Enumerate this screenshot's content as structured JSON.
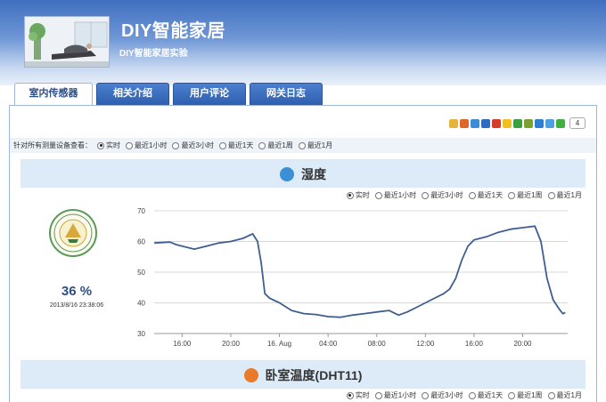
{
  "header": {
    "title": "DIY智能家居",
    "subtitle": "DIY智能家居实验"
  },
  "tabs": [
    {
      "label": "室内传感器",
      "active": true
    },
    {
      "label": "相关介绍",
      "active": false
    },
    {
      "label": "用户评论",
      "active": false
    },
    {
      "label": "网关日志",
      "active": false
    }
  ],
  "share": {
    "icons": [
      "qzone-icon",
      "rss-icon",
      "email-icon",
      "renren-icon",
      "weibo-icon",
      "star-icon",
      "douban-icon",
      "kaixin-icon",
      "tencent-icon",
      "bookmark-icon",
      "plus-icon"
    ],
    "icon_colors": [
      "#e7b33a",
      "#e0662a",
      "#3a8cd7",
      "#2d6cc4",
      "#d63a2a",
      "#f0c020",
      "#3aa040",
      "#7aa030",
      "#2d7fd1",
      "#4aa0e0",
      "#3fb040"
    ],
    "count": "4"
  },
  "filter": {
    "label": "针对所有测量设备查看：",
    "options": [
      "实时",
      "最近1小时",
      "最近3小时",
      "最近1天",
      "最近1周",
      "最近1月"
    ],
    "selected": 0
  },
  "sensors": [
    {
      "title": "湿度",
      "icon": "water-drop-icon",
      "icon_color": "#3a8fd6",
      "options": [
        "实时",
        "最近1小时",
        "最近3小时",
        "最近1天",
        "最近1周",
        "最近1月"
      ],
      "selected": 0,
      "reading": "36 %",
      "timestamp": "2013/8/16 23:38:06"
    },
    {
      "title": "卧室温度(DHT11)",
      "icon": "thermometer-icon",
      "icon_color": "#e87a2a",
      "options": [
        "实时",
        "最近1小时",
        "最近3小时",
        "最近1天",
        "最近1周",
        "最近1月"
      ],
      "selected": 0
    }
  ],
  "chart_data": {
    "type": "line",
    "title": "",
    "xlabel": "",
    "ylabel": "",
    "ylim": [
      30,
      70
    ],
    "yticks": [
      30,
      40,
      50,
      60,
      70
    ],
    "xticks": [
      "16:00",
      "20:00",
      "16. Aug",
      "04:00",
      "08:00",
      "12:00",
      "16:00",
      "20:00"
    ],
    "xtick_hours": [
      16,
      20,
      24,
      28,
      32,
      36,
      40,
      44
    ],
    "xlim_hours": [
      13.7,
      47.7
    ],
    "grid": true,
    "line_color": "#3e5f8f",
    "series": [
      {
        "x_hours": [
          13.7,
          15.0,
          15.5,
          16.0,
          17.0,
          18.0,
          19.0,
          20.0,
          21.0,
          21.8,
          22.2,
          22.5,
          22.8,
          23.2,
          24.0,
          25.0,
          26.0,
          27.0,
          28.0,
          29.0,
          30.0,
          31.0,
          32.0,
          33.0,
          33.8,
          34.5,
          35.5,
          36.5,
          37.5,
          38.0,
          38.5,
          39.0,
          39.5,
          40.0,
          41.0,
          42.0,
          43.0,
          44.0,
          45.0,
          45.5,
          46.0,
          46.5,
          47.0,
          47.3,
          47.5
        ],
        "y": [
          59.5,
          59.8,
          59.0,
          58.5,
          57.5,
          58.5,
          59.5,
          60.0,
          61.0,
          62.5,
          60.0,
          53.0,
          43.0,
          41.5,
          40.0,
          37.5,
          36.5,
          36.2,
          35.5,
          35.3,
          36.0,
          36.5,
          37.0,
          37.5,
          36.0,
          37.0,
          39.0,
          41.0,
          43.0,
          44.5,
          48.0,
          54.0,
          58.5,
          60.5,
          61.5,
          63.0,
          64.0,
          64.5,
          65.0,
          60.0,
          48.0,
          41.0,
          38.0,
          36.5,
          36.8
        ]
      }
    ]
  }
}
